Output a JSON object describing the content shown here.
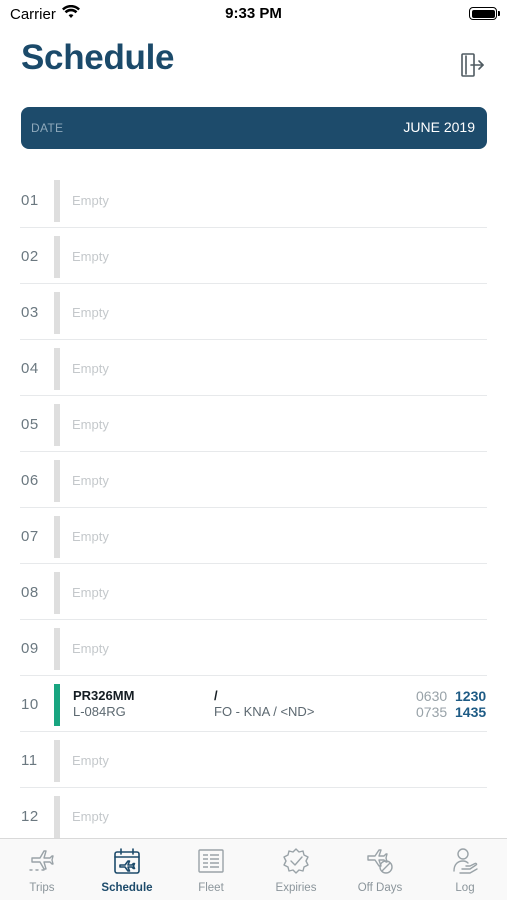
{
  "status_bar": {
    "carrier": "Carrier",
    "time": "9:33 PM"
  },
  "header": {
    "title": "Schedule",
    "logout_icon": "logout-door-icon"
  },
  "date_bar": {
    "label": "DATE",
    "value": "JUNE 2019"
  },
  "empty_label": "Empty",
  "days": [
    {
      "day": "01",
      "status": "empty"
    },
    {
      "day": "02",
      "status": "empty"
    },
    {
      "day": "03",
      "status": "empty"
    },
    {
      "day": "04",
      "status": "empty"
    },
    {
      "day": "05",
      "status": "empty"
    },
    {
      "day": "06",
      "status": "empty"
    },
    {
      "day": "07",
      "status": "empty"
    },
    {
      "day": "08",
      "status": "empty"
    },
    {
      "day": "09",
      "status": "empty"
    },
    {
      "day": "10",
      "status": "flight",
      "flight": "PR326MM",
      "registration": "L-084RG",
      "slash": "/",
      "route": "FO - KNA / <ND>",
      "times": [
        {
          "a": "0630",
          "b": "1230"
        },
        {
          "a": "0735",
          "b": "1435"
        }
      ]
    },
    {
      "day": "11",
      "status": "empty"
    },
    {
      "day": "12",
      "status": "empty"
    }
  ],
  "colors": {
    "primary": "#1d4b6b",
    "flight_marker": "#18a580",
    "empty_marker": "#dedede"
  },
  "tabs": [
    {
      "label": "Trips",
      "icon": "airplane-route-icon",
      "active": false
    },
    {
      "label": "Schedule",
      "icon": "calendar-flight-icon",
      "active": true
    },
    {
      "label": "Fleet",
      "icon": "fleet-board-icon",
      "active": false
    },
    {
      "label": "Expiries",
      "icon": "badge-check-icon",
      "active": false
    },
    {
      "label": "Off Days",
      "icon": "plane-off-icon",
      "active": false
    },
    {
      "label": "Log",
      "icon": "person-hand-icon",
      "active": false
    }
  ]
}
